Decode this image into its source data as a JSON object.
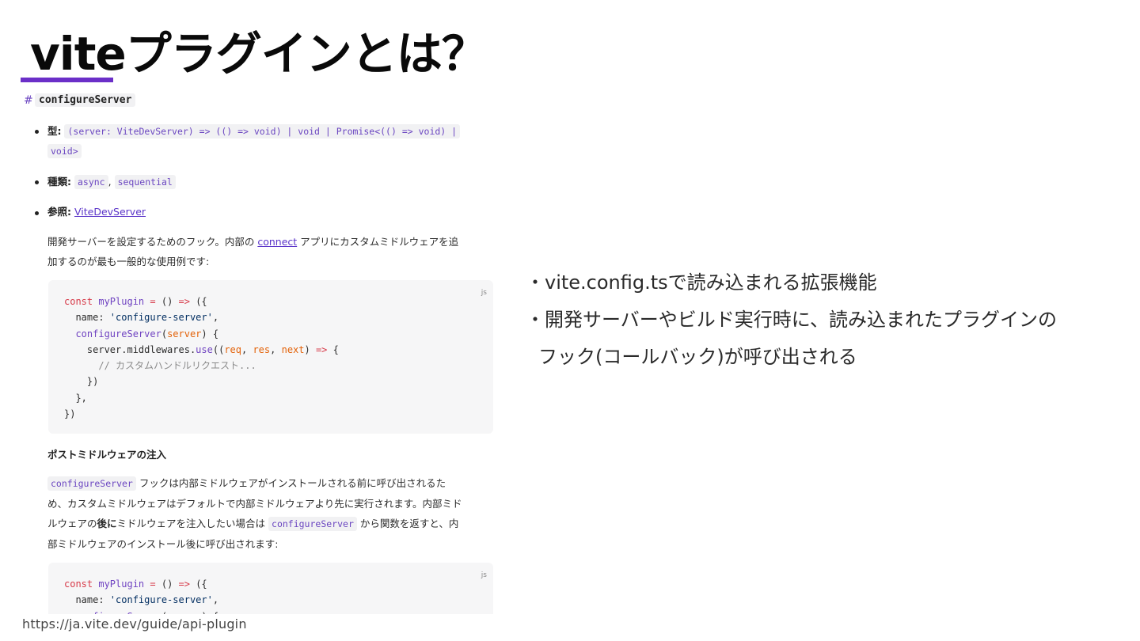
{
  "slide": {
    "title": "viteプラグインとは？",
    "points": [
      "・vite.config.tsで読み込まれる拡張機能",
      "・開発サーバーやビルド実行時に、読み込まれたプラグインの",
      "フック(コールバック)が呼び出される"
    ],
    "source_url": "https://ja.vite.dev/guide/api-plugin"
  },
  "doc": {
    "hash": "#",
    "heading": "configureServer",
    "type_label": "型:",
    "type_value_1": "(server: ViteDevServer) => (() => void) | void | Promise<(() => void) |",
    "type_value_2": "void>",
    "kind_label": "種類:",
    "kind_async": "async",
    "kind_sep": ",",
    "kind_sequential": "sequential",
    "ref_label": "参照:",
    "ref_link": "ViteDevServer",
    "desc_1_pre": "開発サーバーを設定するためのフック。内部の ",
    "desc_1_link": "connect",
    "desc_1_post": " アプリにカスタムミドルウェアを追",
    "desc_2": "加するのが最も一般的な使用例です:",
    "code_lang": "js",
    "subhead": "ポストミドルウェアの注入",
    "post_code": "configureServer",
    "post_1": " フックは内部ミドルウェアがインストールされる前に呼び出されるた",
    "post_2": "め、カスタムミドルウェアはデフォルトで内部ミドルウェアより先に実行されます。内部ミド",
    "post_3_pre": "ルウェアの",
    "post_3_bold": "後に",
    "post_3_mid": "ミドルウェアを注入したい場合は ",
    "post_3_code": "configureServer",
    "post_3_post": " から関数を返すと、内",
    "post_4": "部ミドルウェアのインストール後に呼び出されます:",
    "code2_lang": "js"
  }
}
